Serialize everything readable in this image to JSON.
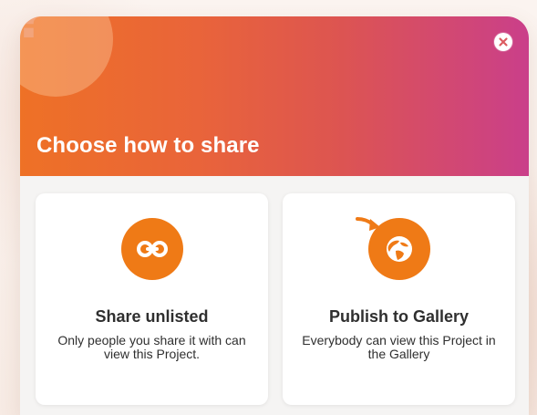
{
  "modal": {
    "help_glyph": "?",
    "title": "Choose how to share",
    "close_icon": "close-icon"
  },
  "options": [
    {
      "title": "Share unlisted",
      "description": "Only people you share it with can view this Project.",
      "icon": "link-icon"
    },
    {
      "title": "Publish to Gallery",
      "description": "Everybody can view this Project in the Gallery",
      "icon": "globe-icon"
    }
  ],
  "colors": {
    "header_gradient_start": "#ee7126",
    "header_gradient_end": "#ca3f8a",
    "accent_orange": "#ef7a16",
    "card_background": "#ffffff",
    "body_background": "#f5f4f3",
    "text_dark": "#2f2f2f"
  }
}
